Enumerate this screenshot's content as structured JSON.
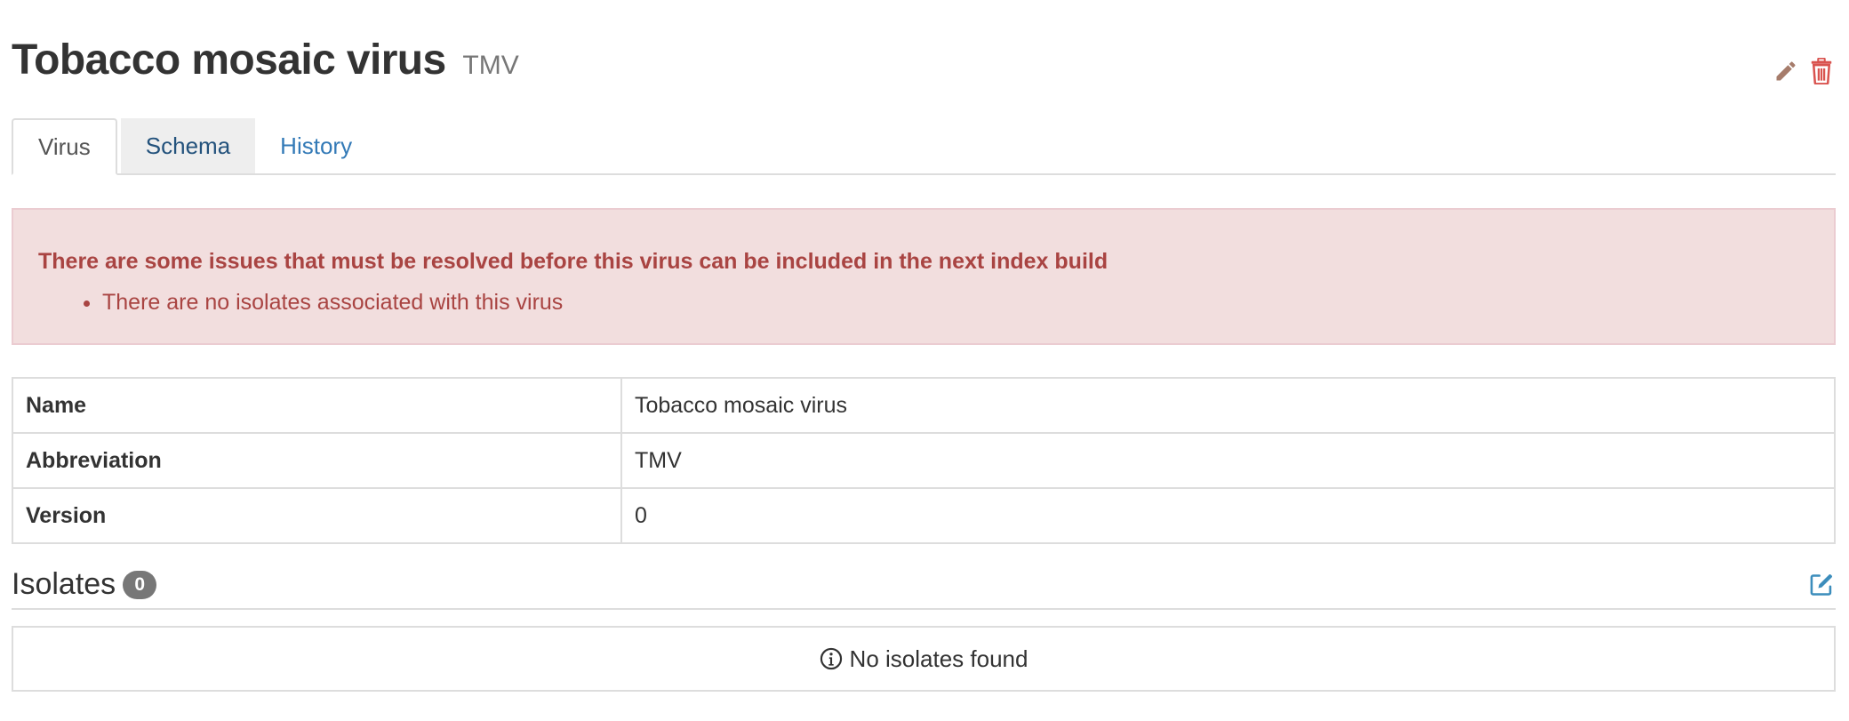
{
  "header": {
    "title": "Tobacco mosaic virus",
    "abbreviation": "TMV",
    "edit_icon": "pencil-icon",
    "delete_icon": "trash-icon",
    "edit_color": "#a67c6b",
    "delete_color": "#d9534f"
  },
  "tabs": [
    {
      "label": "Virus",
      "active": true
    },
    {
      "label": "Schema",
      "active": false
    },
    {
      "label": "History",
      "active": false
    }
  ],
  "alert": {
    "title": "There are some issues that must be resolved before this virus can be included in the next index build",
    "items": [
      "There are no isolates associated with this virus"
    ],
    "color": "#a94442",
    "background": "#f2dede"
  },
  "details": {
    "rows": [
      {
        "key": "Name",
        "value": "Tobacco mosaic virus"
      },
      {
        "key": "Abbreviation",
        "value": "TMV"
      },
      {
        "key": "Version",
        "value": "0"
      }
    ]
  },
  "isolates": {
    "title": "Isolates",
    "count": "0",
    "edit_icon": "edit-square-icon",
    "empty_icon": "info-circle-icon",
    "empty_text": "No isolates found",
    "accent": "#3c8dbc"
  }
}
